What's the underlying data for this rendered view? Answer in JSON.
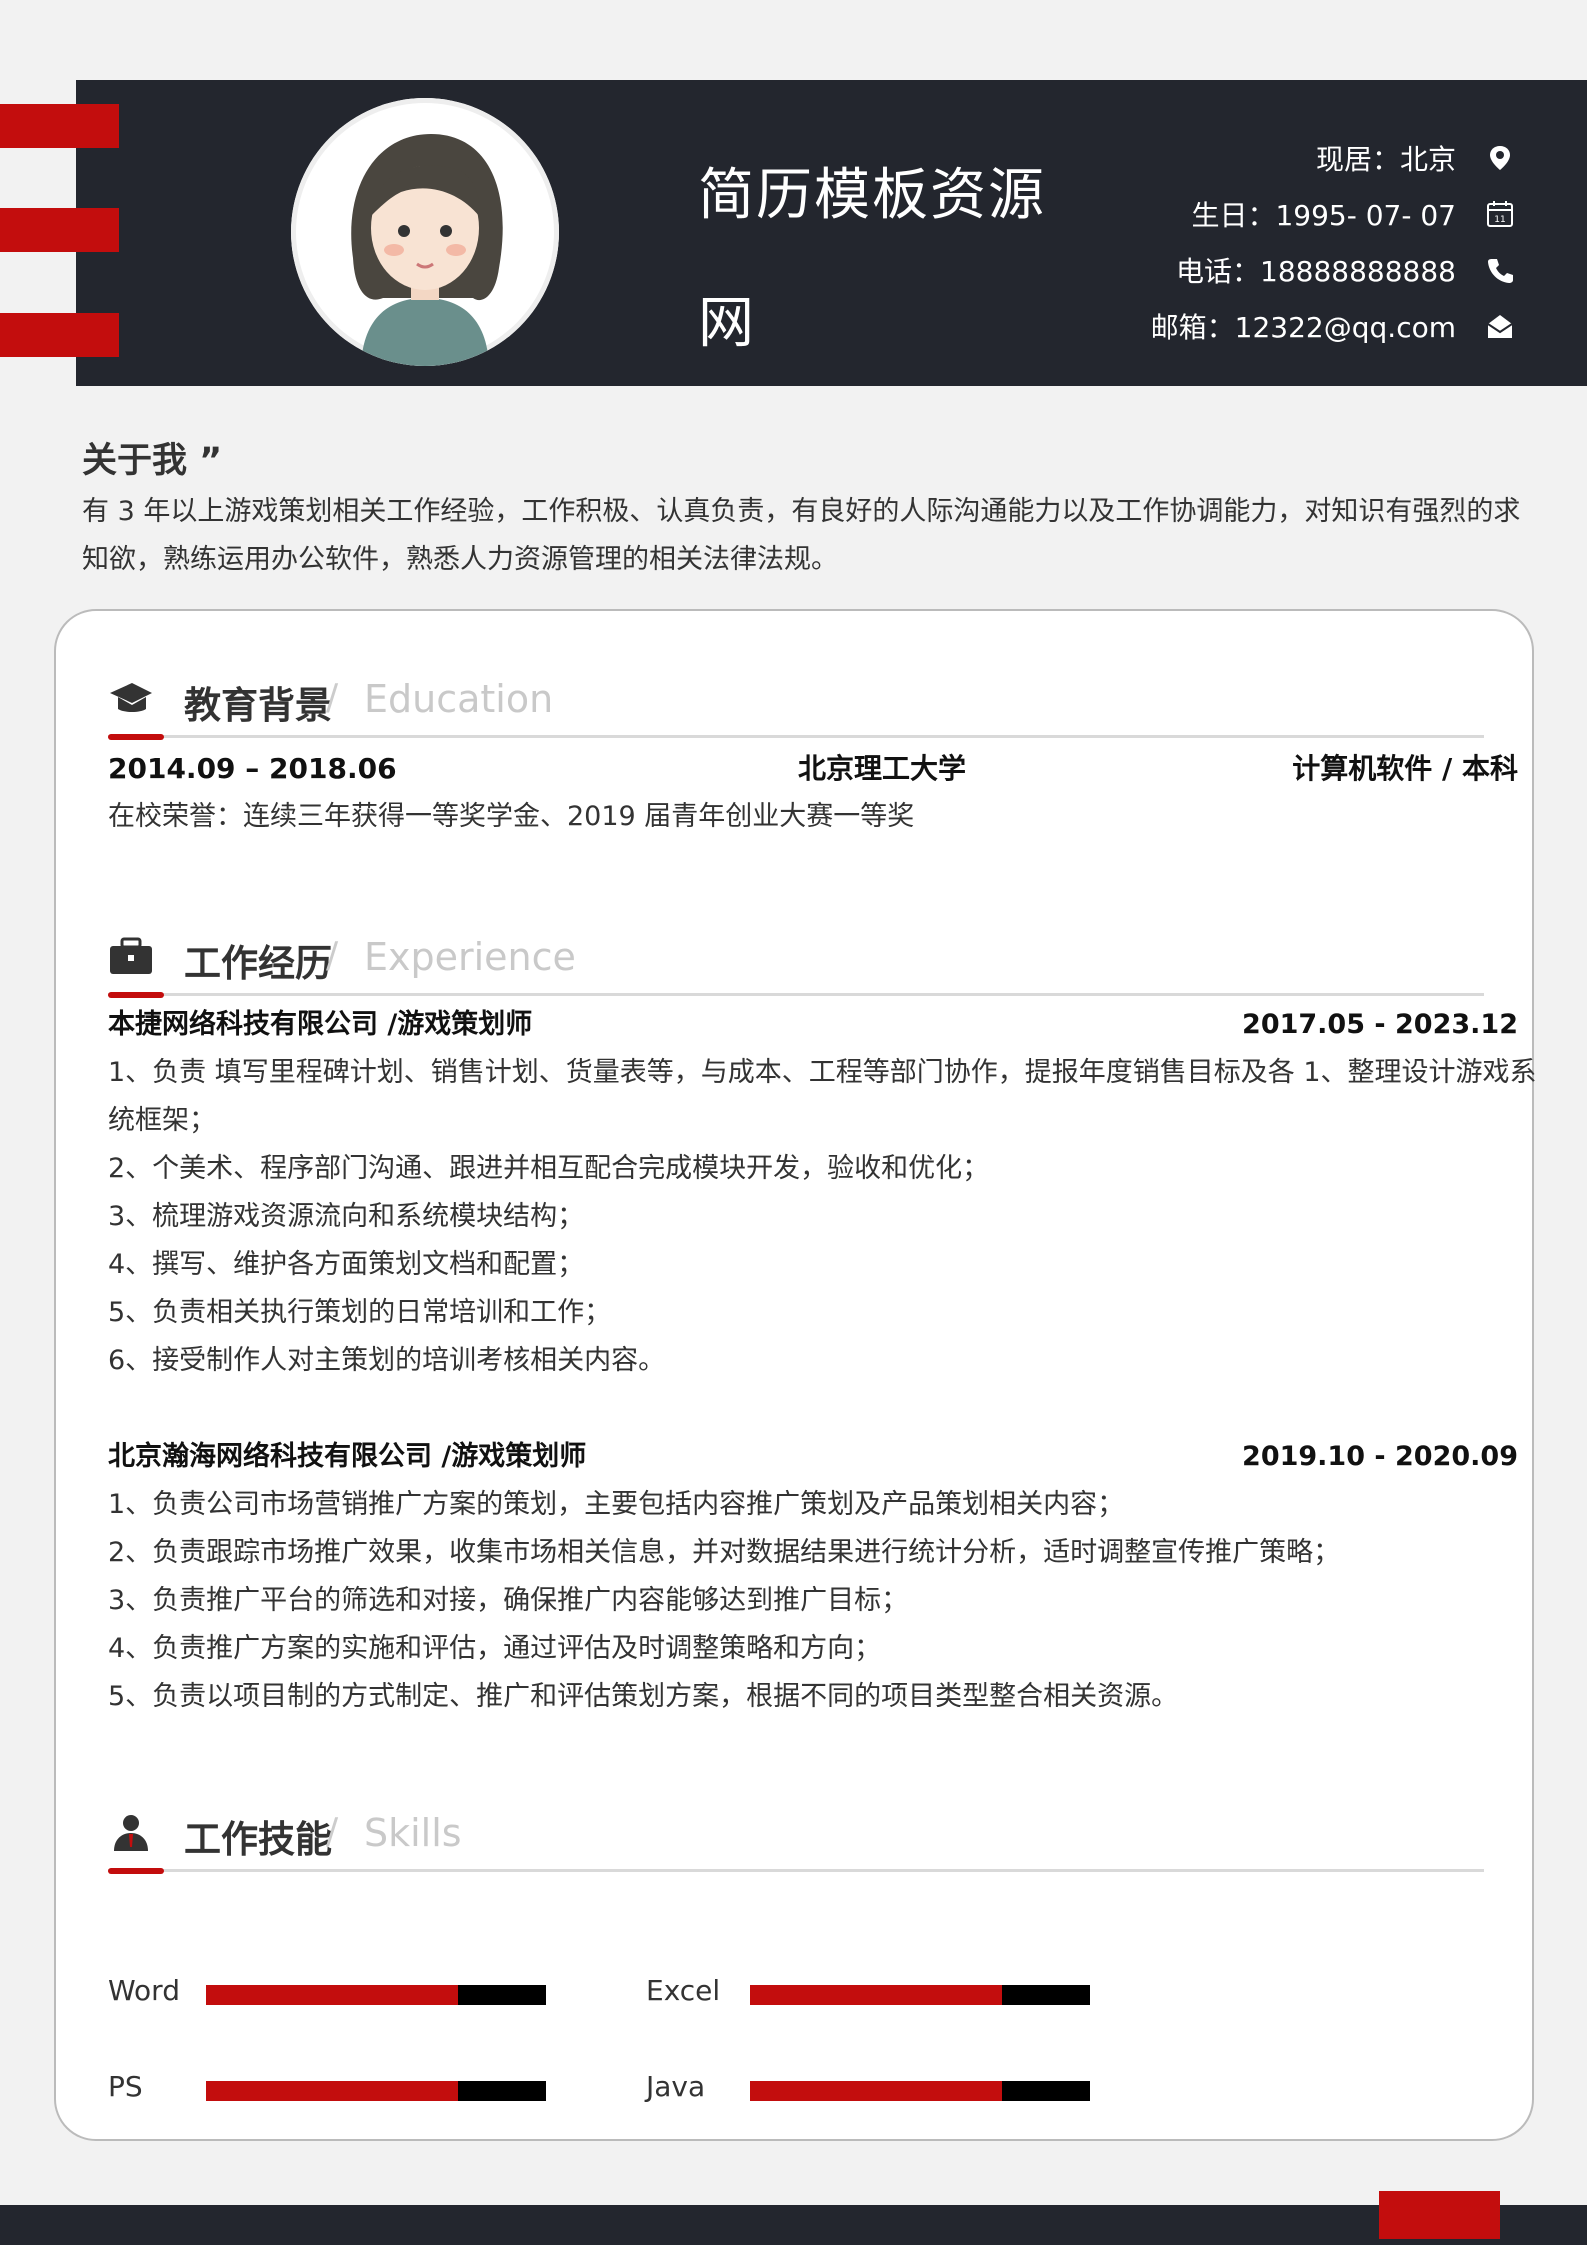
{
  "header": {
    "title": "简历模板资源网",
    "contacts": [
      {
        "text": "现居：北京",
        "icon": "location-pin-icon"
      },
      {
        "text": "生日：1995- 07- 07",
        "icon": "calendar-icon"
      },
      {
        "text": "电话：18888888888",
        "icon": "phone-icon"
      },
      {
        "text": "邮箱：12322@qq.com",
        "icon": "envelope-icon"
      }
    ]
  },
  "about": {
    "title": "关于我 ”",
    "text": "有 3 年以上游戏策划相关工作经验，工作积极、认真负责，有良好的人际沟通能力以及工作协调能力，对知识有强烈的求知欲，熟练运用办公软件，熟悉人力资源管理的相关法律法规。"
  },
  "education": {
    "title_cn": "教育背景",
    "title_en": "Education",
    "slash": "/",
    "period": "2014.09 – 2018.06",
    "school": "北京理工大学",
    "major": "计算机软件 / 本科",
    "honor": "在校荣誉：连续三年获得一等奖学金、2019 届青年创业大赛一等奖"
  },
  "experience": {
    "title_cn": "工作经历",
    "title_en": "Experience",
    "slash": "/",
    "jobs": [
      {
        "company": "本捷网络科技有限公司 /游戏策划师",
        "period": "2017.05 - 2023.12",
        "items": [
          "1、负责 填写里程碑计划、销售计划、货量表等，与成本、工程等部门协作，提报年度销售目标及各 1、整理设计游戏系统框架；",
          "2、个美术、程序部门沟通、跟进并相互配合完成模块开发，验收和优化；",
          "3、梳理游戏资源流向和系统模块结构；",
          "4、撰写、维护各方面策划文档和配置；",
          "5、负责相关执行策划的日常培训和工作；",
          "6、接受制作人对主策划的培训考核相关内容。"
        ]
      },
      {
        "company": "北京瀚海网络科技有限公司 /游戏策划师",
        "period": "2019.10 - 2020.09",
        "items": [
          "1、负责公司市场营销推广方案的策划，主要包括内容推广策划及产品策划相关内容；",
          "2、负责跟踪市场推广效果，收集市场相关信息，并对数据结果进行统计分析，适时调整宣传推广策略；",
          "3、负责推广平台的筛选和对接，确保推广内容能够达到推广目标；",
          "4、负责推广方案的实施和评估，通过评估及时调整策略和方向；",
          "5、负责以项目制的方式制定、推广和评估策划方案，根据不同的项目类型整合相关资源。"
        ]
      }
    ]
  },
  "skills": {
    "title_cn": "工作技能",
    "title_en": "Skills",
    "slash": "/",
    "items": [
      {
        "name": "Word",
        "level": 0.74
      },
      {
        "name": "Excel",
        "level": 0.74
      },
      {
        "name": "PS",
        "level": 0.74
      },
      {
        "name": "Java",
        "level": 0.74
      }
    ]
  },
  "colors": {
    "accent": "#c30d0d",
    "dark": "#23262e"
  }
}
